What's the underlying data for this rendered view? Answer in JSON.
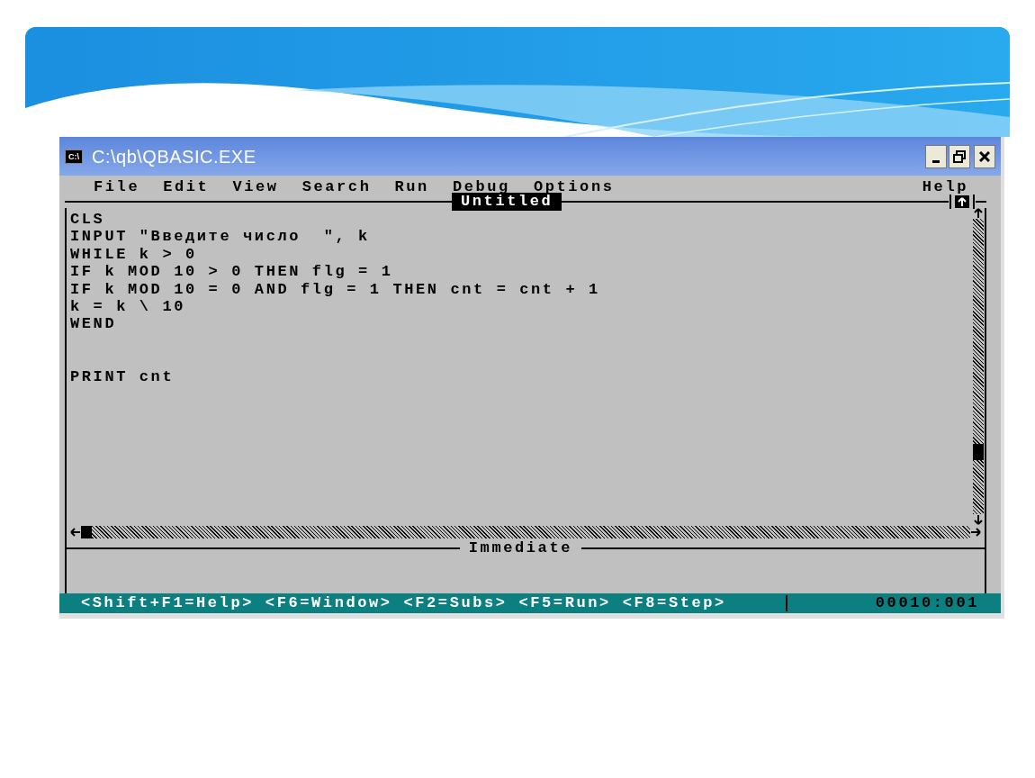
{
  "window": {
    "icon_label": "C:\\",
    "title": "C:\\qb\\QBASIC.EXE"
  },
  "menu": {
    "items": [
      "File",
      "Edit",
      "View",
      "Search",
      "Run",
      "Debug",
      "Options"
    ],
    "help": "Help"
  },
  "editor": {
    "title": "Untitled",
    "lines": [
      {
        "kind": "code",
        "text": "CLS"
      },
      {
        "kind": "code",
        "text": "INPUT \"Введите число  \", k"
      },
      {
        "kind": "code",
        "text": "WHILE k > 0"
      },
      {
        "kind": "code",
        "text": "IF k MOD 10 > 0 THEN flg = 1"
      },
      {
        "kind": "code",
        "text": "IF k MOD 10 = 0 AND flg = 1 THEN cnt = cnt + 1"
      },
      {
        "kind": "code",
        "text": "k = k \\ 10"
      },
      {
        "kind": "code",
        "text": "WEND"
      },
      {
        "kind": "blank"
      },
      {
        "kind": "blank"
      },
      {
        "kind": "code",
        "text": "PRINT cnt"
      }
    ]
  },
  "immediate": {
    "title": "Immediate"
  },
  "status_bar": {
    "hints": "<Shift+F1=Help> <F6=Window> <F2=Subs> <F5=Run> <F8=Step>",
    "position": "00010:001"
  }
}
